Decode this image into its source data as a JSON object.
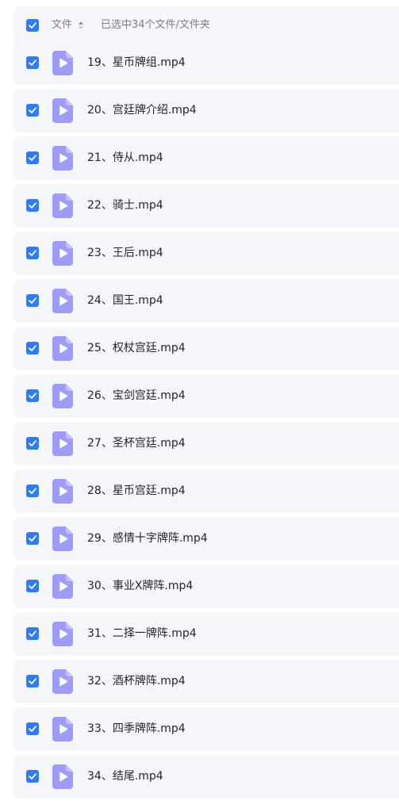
{
  "header": {
    "column_label": "文件",
    "selection_status": "已选中34个文件/文件夹"
  },
  "icons": {
    "checkbox": "checkbox-checked-icon",
    "file": "video-file-icon",
    "sort": "sort-icon"
  },
  "colors": {
    "checkbox": "#2b7cf6",
    "file_icon": "#9e9cf6",
    "row_bg": "#f5f6fa"
  },
  "files": [
    {
      "name": "19、星币牌组.mp4",
      "selected": true
    },
    {
      "name": "20、宫廷牌介绍.mp4",
      "selected": true
    },
    {
      "name": "21、侍从.mp4",
      "selected": true
    },
    {
      "name": "22、骑士.mp4",
      "selected": true
    },
    {
      "name": "23、王后.mp4",
      "selected": true
    },
    {
      "name": "24、国王.mp4",
      "selected": true
    },
    {
      "name": "25、权杖宫廷.mp4",
      "selected": true
    },
    {
      "name": "26、宝剑宫廷.mp4",
      "selected": true
    },
    {
      "name": "27、圣杯宫廷.mp4",
      "selected": true
    },
    {
      "name": "28、星币宫廷.mp4",
      "selected": true
    },
    {
      "name": "29、感情十字牌阵.mp4",
      "selected": true
    },
    {
      "name": "30、事业X牌阵.mp4",
      "selected": true
    },
    {
      "name": "31、二择一牌阵.mp4",
      "selected": true
    },
    {
      "name": "32、酒杯牌阵.mp4",
      "selected": true
    },
    {
      "name": "33、四季牌阵.mp4",
      "selected": true
    },
    {
      "name": "34、结尾.mp4",
      "selected": true
    }
  ]
}
